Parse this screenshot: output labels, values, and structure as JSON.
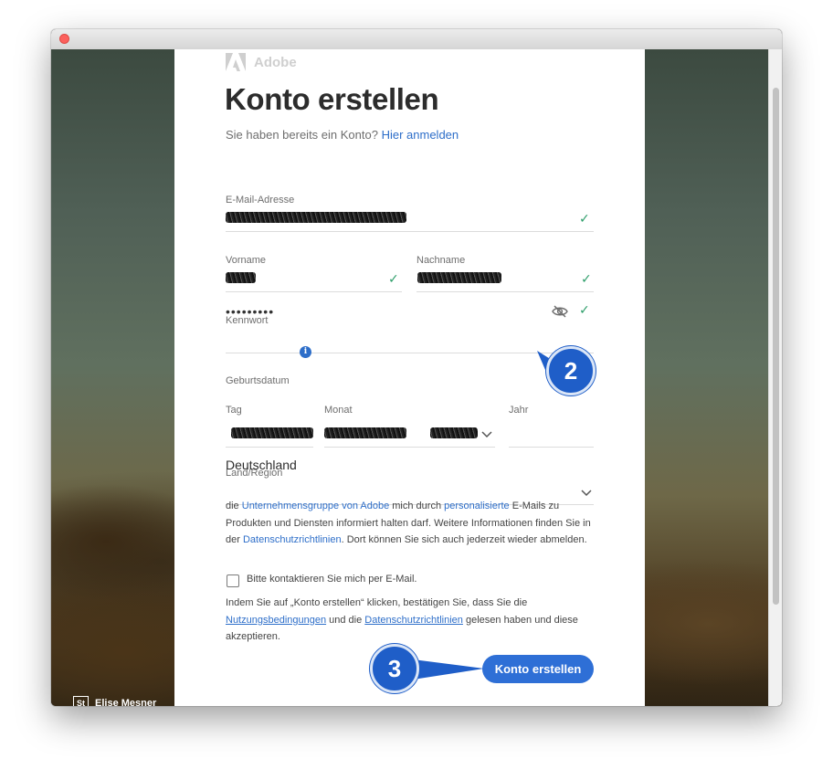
{
  "brand": {
    "name": "Adobe",
    "color": "#cfcfcf"
  },
  "page": {
    "title": "Konto erstellen",
    "signin_prompt": "Sie haben bereits ein Konto?",
    "signin_link": "Hier anmelden"
  },
  "form": {
    "email": {
      "label": "E-Mail-Adresse",
      "valid": true,
      "value_redacted": true
    },
    "first_name": {
      "label": "Vorname",
      "valid": true,
      "value_redacted": true
    },
    "last_name": {
      "label": "Nachname",
      "valid": true,
      "value_redacted": true
    },
    "password": {
      "label": "Kennwort",
      "value": "•••••••••",
      "valid": true
    },
    "birthdate": {
      "label": "Geburtsdatum",
      "day_label": "Tag",
      "month_label": "Monat",
      "year_label": "Jahr",
      "year_value": ""
    },
    "country": {
      "label": "Land/Region",
      "value": "Deutschland"
    }
  },
  "consent": {
    "t1": "die ",
    "link1": "Unternehmensgruppe von Adobe",
    "t2": " mich durch ",
    "link2": "personalisierte",
    "t3": " E-Mails zu Produkten und Diensten informiert halten darf. Weitere Informationen finden Sie in der ",
    "link3": "Datenschutzrichtlinien",
    "t4": ". Dort können Sie sich auch jederzeit wieder abmelden."
  },
  "checkbox": {
    "label": "Bitte kontaktieren Sie mich per E-Mail.",
    "checked": false
  },
  "terms": {
    "t1": "Indem Sie auf „Konto erstellen“ klicken, bestätigen Sie, dass Sie die ",
    "link1": "Nutzungsbedingungen",
    "t2": " und die ",
    "link2": "Datenschutzrichtlinien",
    "t3": " gelesen haben und diese akzeptieren."
  },
  "submit_label": "Konto erstellen",
  "callouts": {
    "step2": "2",
    "step3": "3",
    "color": "#1f5ec8"
  },
  "photo_credit": {
    "icon": "St",
    "name": "Elise Mesner"
  },
  "colors": {
    "accent": "#2e6fd6",
    "link": "#2d6ec9",
    "valid": "#2e9e6a"
  },
  "icons": [
    "close-icon",
    "adobe-logo-icon",
    "check-icon",
    "eye-slash-icon",
    "info-icon",
    "chevron-down-icon",
    "stock-icon"
  ]
}
